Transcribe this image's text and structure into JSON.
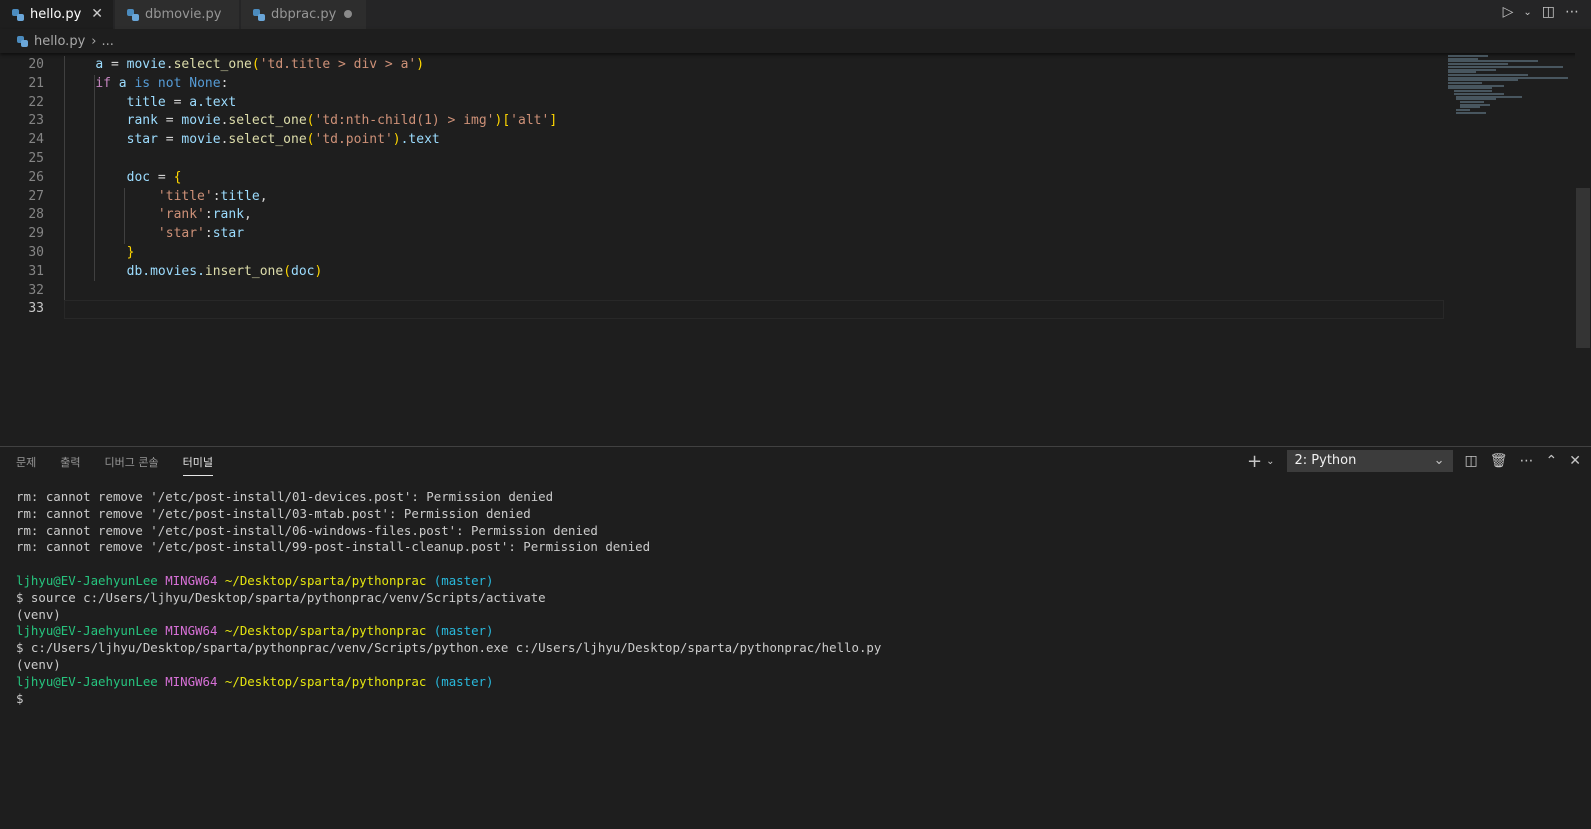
{
  "tabs": [
    {
      "label": "hello.py",
      "active": true,
      "close": "✕"
    },
    {
      "label": "dbmovie.py",
      "active": false
    },
    {
      "label": "dbprac.py",
      "active": false,
      "dirty": true
    }
  ],
  "breadcrumb": {
    "file": "hello.py",
    "sep": "›",
    "more": "..."
  },
  "editor": {
    "line_numbers": [
      "20",
      "21",
      "22",
      "23",
      "24",
      "25",
      "26",
      "27",
      "28",
      "29",
      "30",
      "31",
      "32",
      "33"
    ],
    "current_line": "33",
    "code": {
      "l20_a": "a",
      "l20_eq": " = ",
      "l20_movie": "movie",
      "l20_dot": ".",
      "l20_fn": "select_one",
      "l20_str": "'td.title > div > a'",
      "l21_if": "if",
      "l21_a": " a ",
      "l21_is": "is not",
      "l21_none": " None",
      "l21_colon": ":",
      "l22_title": "title",
      "l22_eq": " = ",
      "l22_a": "a",
      "l22_text": ".text",
      "l23_rank": "rank",
      "l23_eq": " = ",
      "l23_movie": "movie",
      "l23_fn": "select_one",
      "l23_str": "'td:nth-child(1) > img'",
      "l23_key": "'alt'",
      "l24_star": "star",
      "l24_eq": " = ",
      "l24_movie": "movie",
      "l24_fn": "select_one",
      "l24_str": "'td.point'",
      "l24_text": ".text",
      "l26_doc": "doc",
      "l26_eq": " = ",
      "l27_key": "'title'",
      "l27_val": "title",
      "l28_key": "'rank'",
      "l28_val": "rank",
      "l29_key": "'star'",
      "l29_val": "star",
      "l31_db": "db",
      "l31_movies": ".movies.",
      "l31_fn": "insert_one",
      "l31_doc": "doc"
    }
  },
  "panel": {
    "tabs": [
      "문제",
      "출력",
      "디버그 콘솔",
      "터미널"
    ],
    "active_tab": "터미널",
    "terminal_select": "2: Python",
    "terminal": {
      "err1": "rm: cannot remove '/etc/post-install/01-devices.post': Permission denied",
      "err2": "rm: cannot remove '/etc/post-install/03-mtab.post': Permission denied",
      "err3": "rm: cannot remove '/etc/post-install/06-windows-files.post': Permission denied",
      "err4": "rm: cannot remove '/etc/post-install/99-post-install-cleanup.post': Permission denied",
      "user": "ljhyu@EV-JaehyunLee",
      "env": "MINGW64",
      "path": "~/Desktop/sparta/pythonprac",
      "branch": "(master)",
      "cmd1": "$ source c:/Users/ljhyu/Desktop/sparta/pythonprac/venv/Scripts/activate",
      "venv": "(venv)",
      "cmd2": "$ c:/Users/ljhyu/Desktop/sparta/pythonprac/venv/Scripts/python.exe c:/Users/ljhyu/Desktop/sparta/pythonprac/hello.py",
      "prompt": "$"
    }
  },
  "colors": {
    "editor_bg": "#1e1e1e",
    "string": "#ce9178",
    "function": "#dcdcaa",
    "variable": "#9cdcfe",
    "keyword": "#c586c0"
  }
}
